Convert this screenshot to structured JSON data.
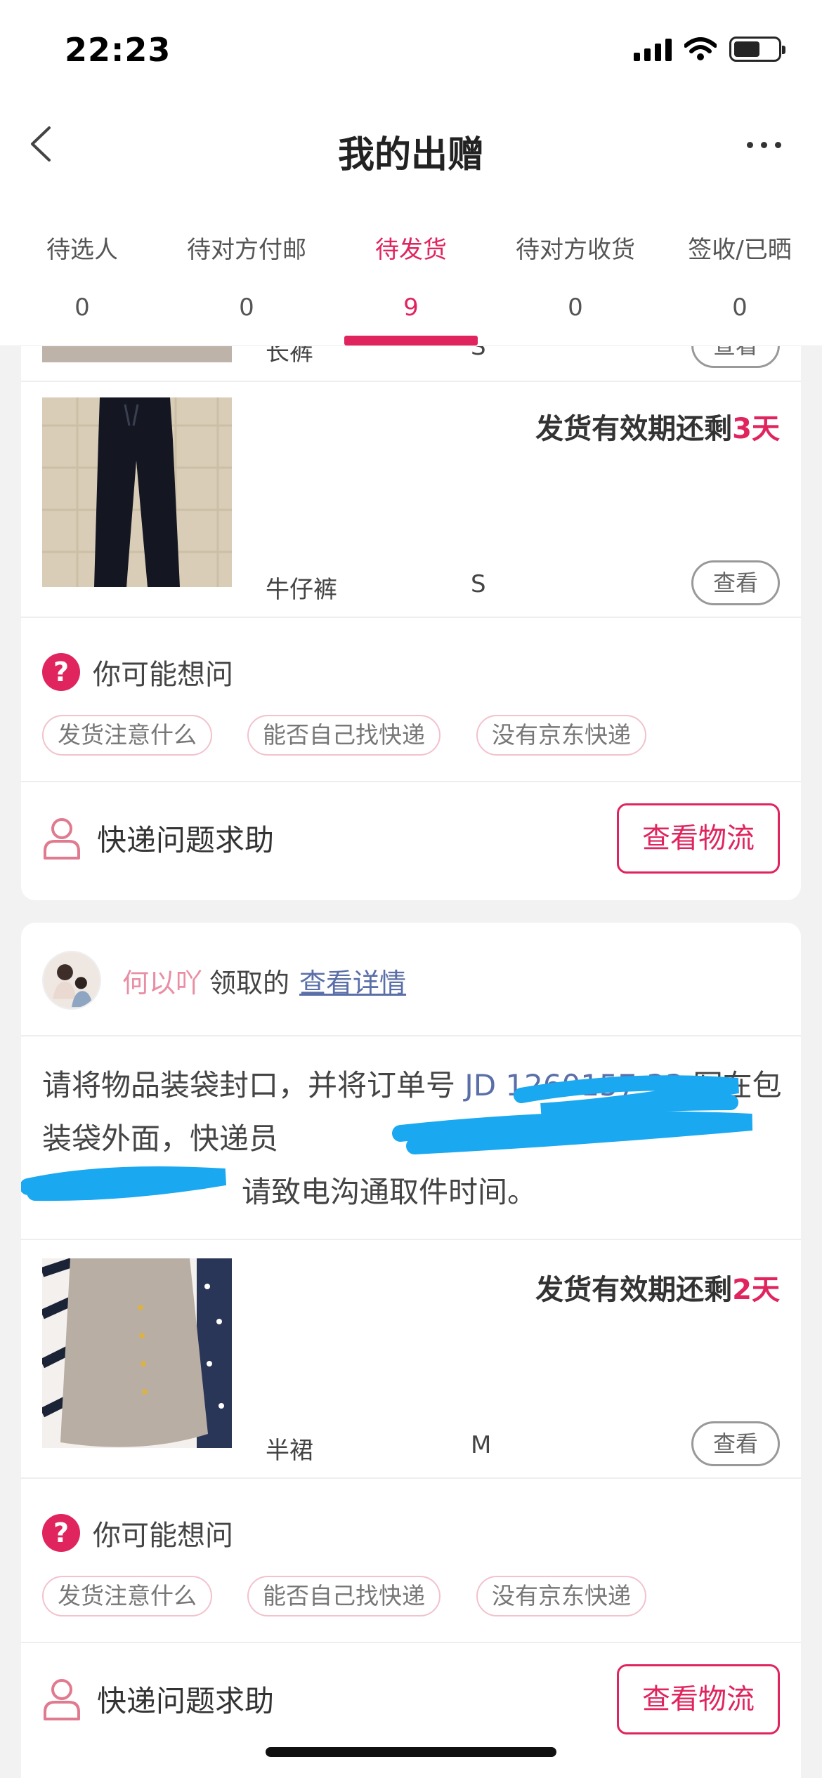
{
  "status_bar": {
    "time": "22:23"
  },
  "header": {
    "title": "我的出赠"
  },
  "tabs": [
    {
      "label": "待选人",
      "count": "0"
    },
    {
      "label": "待对方付邮",
      "count": "0"
    },
    {
      "label": "待发货",
      "count": "9",
      "active": true
    },
    {
      "label": "待对方收货",
      "count": "0"
    },
    {
      "label": "签收/已晒",
      "count": "0"
    }
  ],
  "partial_item": {
    "name": "长裤",
    "size": "S",
    "view_label": "查看"
  },
  "card1": {
    "deadline_prefix": "发货有效期还剩",
    "deadline_value": "3天",
    "item_name": "牛仔裤",
    "item_size": "S",
    "view_label": "查看",
    "faq_title": "你可能想问",
    "faq_chips": [
      "发货注意什么",
      "能否自己找快递",
      "没有京东快递"
    ],
    "help_label": "快递问题求助",
    "logistics_label": "查看物流"
  },
  "card2": {
    "receiver_name": "何以吖",
    "receiver_suffix": "领取的",
    "details_link": "查看详情",
    "instruction_part1": "请将物品装袋封口，并将订单号 ",
    "instruction_order": "JD   1260157 33",
    "instruction_part2": " 写在包装袋外面，快递员",
    "instruction_part3": "请致电沟通取件时间。",
    "deadline_prefix": "发货有效期还剩",
    "deadline_value": "2天",
    "item_name": "半裙",
    "item_size": "M",
    "view_label": "查看",
    "faq_title": "你可能想问",
    "faq_chips": [
      "发货注意什么",
      "能否自己找快递",
      "没有京东快递"
    ],
    "help_label": "快递问题求助",
    "logistics_label": "查看物流"
  },
  "colors": {
    "accent": "#e0245e",
    "link": "#5a6fa8",
    "scribble": "#1aa8f0",
    "background": "#f2f2f2"
  },
  "icons": [
    "back-icon",
    "more-icon",
    "question-icon",
    "person-icon",
    "signal-icon",
    "wifi-icon",
    "battery-icon"
  ]
}
